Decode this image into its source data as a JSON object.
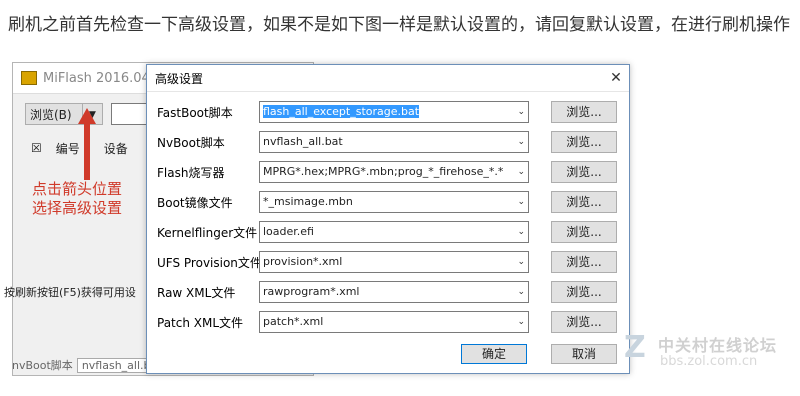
{
  "instruction": "刷机之前首先检查一下高级设置，如果不是如下图一样是默认设置的，请回复默认设置，在进行刷机操作",
  "background_window": {
    "title": "MiFlash 2016.04.01.",
    "browse_label": "浏览(B)",
    "dropdown_glyph": "▼",
    "list_headers": {
      "checkbox": "☒",
      "col1": "编号",
      "col2": "设备"
    },
    "status_text": "按刷新按钮(F5)获得可用设",
    "bottom_text": "nvBoot脚本",
    "bottom_field": "nvflash_all.bat"
  },
  "annotation": {
    "line1": "点击箭头位置",
    "line2": "选择高级设置",
    "color": "#d03a2a"
  },
  "dialog": {
    "title": "高级设置",
    "close_glyph": "✕",
    "rows": [
      {
        "label": "FastBoot脚本",
        "value": "flash_all_except_storage.bat",
        "selected": true,
        "browse": "浏览..."
      },
      {
        "label": "NvBoot脚本",
        "value": "nvflash_all.bat",
        "browse": "浏览..."
      },
      {
        "label": "Flash烧写器",
        "value": "MPRG*.hex;MPRG*.mbn;prog_*_firehose_*.*",
        "browse": "浏览..."
      },
      {
        "label": "Boot镜像文件",
        "value": "*_msimage.mbn",
        "browse": "浏览..."
      },
      {
        "label": "Kernelflinger文件",
        "value": "loader.efi",
        "browse": "浏览..."
      },
      {
        "label": "UFS Provision文件",
        "value": "provision*.xml",
        "browse": "浏览..."
      },
      {
        "label": "Raw XML文件",
        "value": "rawprogram*.xml",
        "browse": "浏览..."
      },
      {
        "label": "Patch XML文件",
        "value": "patch*.xml",
        "browse": "浏览..."
      }
    ],
    "ok_label": "确定",
    "cancel_label": "取消"
  },
  "watermark": {
    "name": "中关村在线论坛",
    "url": "bbs.zol.com.cn"
  }
}
